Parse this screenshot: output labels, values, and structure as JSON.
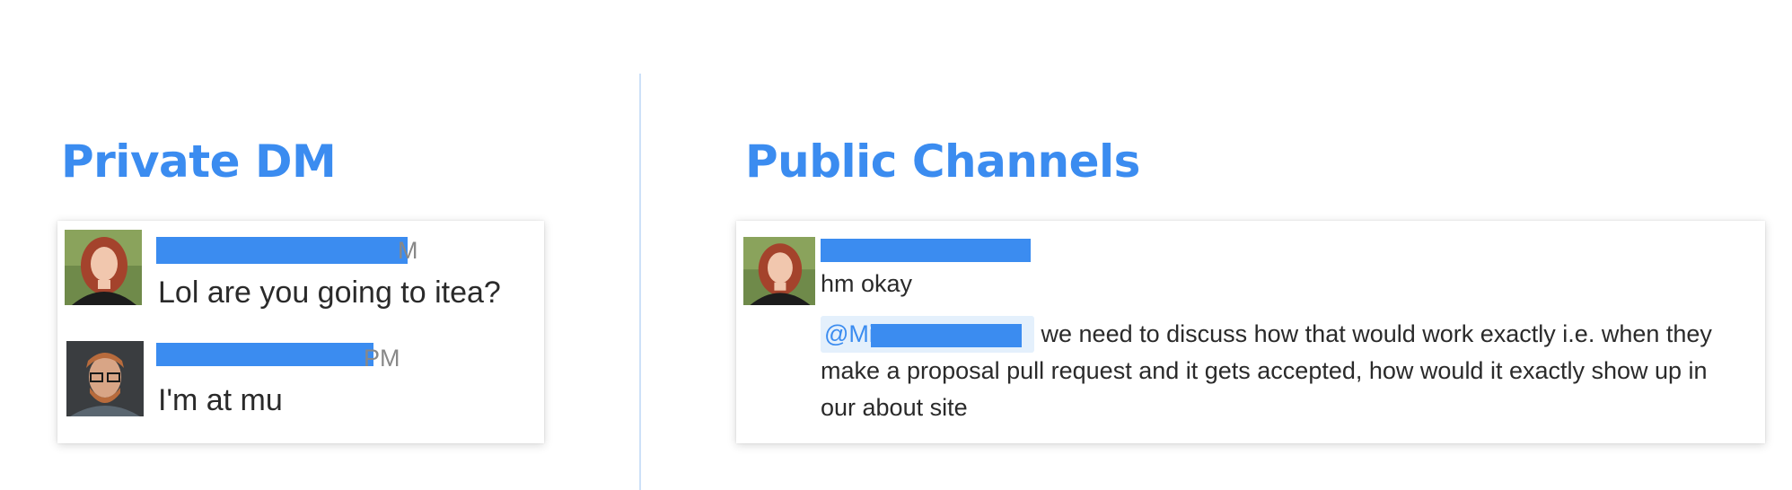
{
  "private_dm": {
    "title": "Private DM",
    "messages": [
      {
        "time_tail": "M",
        "text": "Lol are you going to itea?",
        "avatar_icon": "woman-red-hair-avatar"
      },
      {
        "time_tail": "PM",
        "text": "I'm at mu",
        "avatar_icon": "man-glasses-avatar"
      }
    ]
  },
  "public_channels": {
    "title": "Public Channels",
    "message": {
      "avatar_icon": "woman-red-hair-avatar",
      "text": "hm okay",
      "mention": "@Mi",
      "followup": "we need to discuss how that would work exactly i.e. when they make a proposal pull request and it gets accepted, how would it exactly show up in our about site"
    }
  },
  "colors": {
    "accent": "#3b8cf0",
    "redaction": "#3b8cf0",
    "divider": "#cde1f8",
    "mention_bg": "#e4f0fc"
  }
}
